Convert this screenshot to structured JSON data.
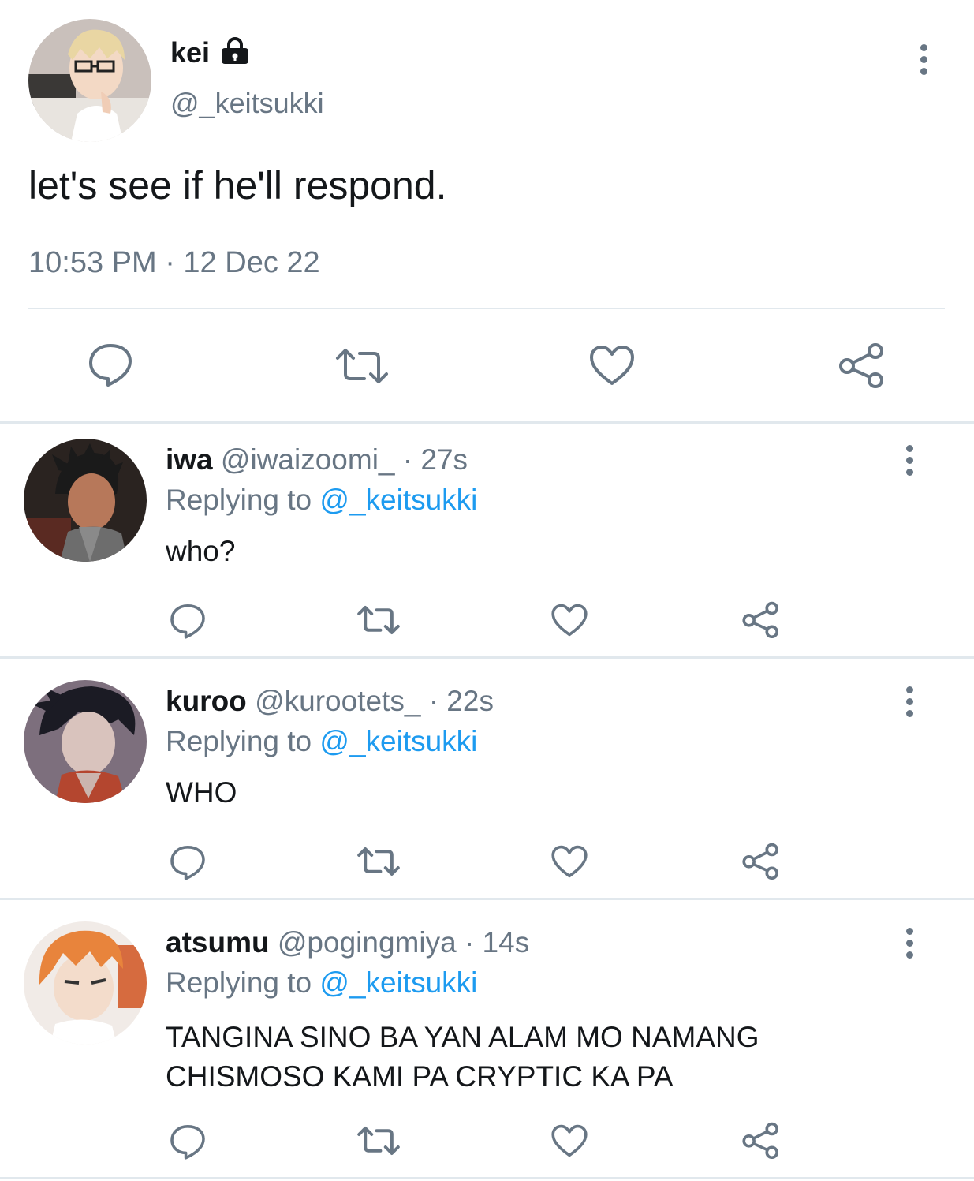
{
  "main_tweet": {
    "display_name": "kei",
    "handle": "@_keitsukki",
    "text": "let's see if he'll respond.",
    "timestamp": "10:53 PM · 12 Dec 22",
    "icons": [
      "lock-icon",
      "more-icon",
      "reply-icon",
      "retweet-icon",
      "like-icon",
      "share-icon"
    ]
  },
  "replies": [
    {
      "display_name": "iwa",
      "handle": "@iwaizoomi_",
      "time": "· 27s",
      "replying_label": "Replying to",
      "replying_to": "@_keitsukki",
      "text": "who?"
    },
    {
      "display_name": "kuroo",
      "handle": "@kurootets_",
      "time": "· 22s",
      "replying_label": "Replying to",
      "replying_to": "@_keitsukki",
      "text": "WHO"
    },
    {
      "display_name": "atsumu",
      "handle": "@pogingmiya",
      "time": "· 14s",
      "replying_label": "Replying to",
      "replying_to": "@_keitsukki",
      "text_line1": "TANGINA SINO BA YAN ALAM MO NAMANG",
      "text_line2": "CHISMOSO KAMI PA CRYPTIC KA PA"
    }
  ],
  "colors": {
    "text": "#14171a",
    "muted": "#687684",
    "link": "#1d9bf0",
    "divider": "#e1e8ed"
  }
}
